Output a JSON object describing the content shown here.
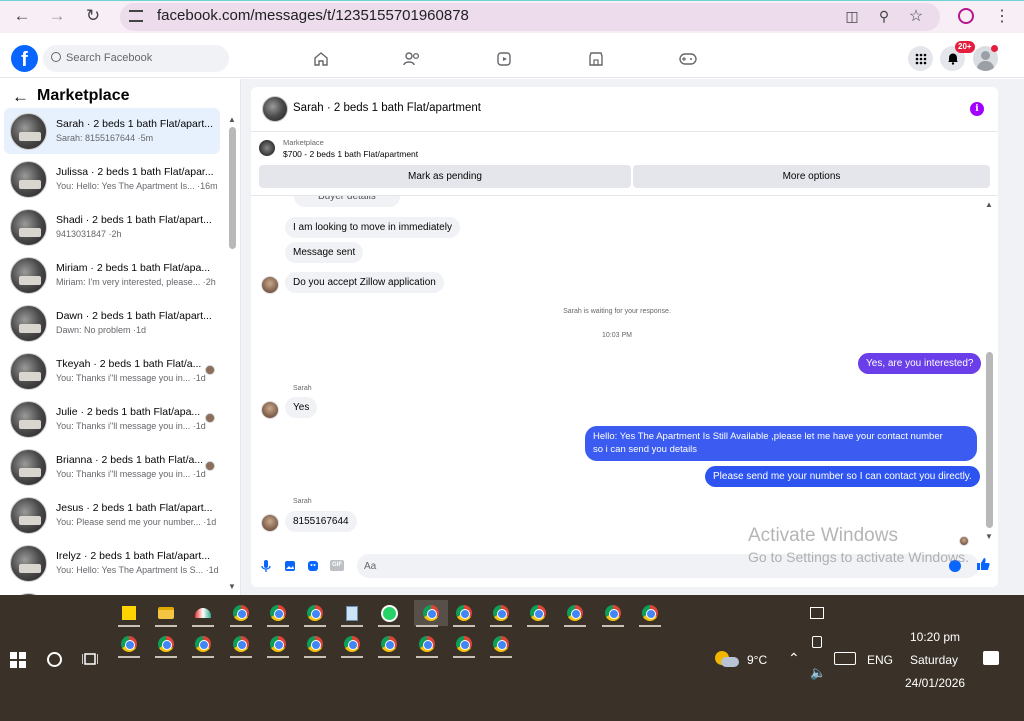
{
  "browser": {
    "url": "facebook.com/messages/t/1235155701960878"
  },
  "fb": {
    "search_placeholder": "Search Facebook",
    "notif_badge": "20+",
    "sidebar_title": "Marketplace"
  },
  "conversations": [
    {
      "title": "Sarah · 2 beds 1 bath Flat/apart...",
      "sub": "Sarah: 8155167644 ·5m"
    },
    {
      "title": "Julissa · 2 beds 1 bath Flat/apar...",
      "sub": "You: Hello: Yes The Apartment Is... ·16m"
    },
    {
      "title": "Shadi · 2 beds 1 bath Flat/apart...",
      "sub": "9413031847 ·2h"
    },
    {
      "title": "Miriam · 2 beds 1 bath Flat/apa...",
      "sub": "Miriam: I'm very interested, please... ·2h"
    },
    {
      "title": "Dawn · 2 beds 1 bath Flat/apart...",
      "sub": "Dawn: No problem ·1d"
    },
    {
      "title": "Tkeyah · 2 beds 1 bath Flat/a...",
      "sub": "You: Thanks i\"ll message you in... ·1d"
    },
    {
      "title": "Julie · 2 beds 1 bath Flat/apa...",
      "sub": "You: Thanks i\"ll message you in... ·1d"
    },
    {
      "title": "Brianna · 2 beds 1 bath Flat/a...",
      "sub": "You: Thanks i\"ll message you in... ·1d"
    },
    {
      "title": "Jesus · 2 beds 1 bath Flat/apart...",
      "sub": "You: Please send me your number... ·1d"
    },
    {
      "title": "Irelyz · 2 beds 1 bath Flat/apart...",
      "sub": "You: Hello: Yes The Apartment Is S... ·1d"
    }
  ],
  "chat": {
    "header_title": "Sarah · 2 beds 1 bath Flat/apartment",
    "listing_label": "Marketplace",
    "listing_title": "$700 - 2 beds 1 bath Flat/apartment",
    "mark_pending": "Mark as pending",
    "more_options": "More options",
    "partial_bubble": "Buyer details",
    "messages": {
      "m1": "I am looking to move in immediately",
      "m2": "Message sent",
      "m3": "Do you accept Zillow application",
      "waiting": "Sarah is waiting for your response.",
      "time": "10:03 PM",
      "r1": "Yes, are you interested?",
      "sender1": "Sarah",
      "m4": "Yes",
      "r2_line1": "Hello: Yes The Apartment Is Still Available ,please let me have your contact number",
      "r2_line2": "so i can send you details",
      "r3": "Please send me your number so I can contact you directly.",
      "sender2": "Sarah",
      "m5": "8155167644"
    },
    "composer_placeholder": "Aa"
  },
  "watermark": {
    "line1": "Activate Windows",
    "line2": "Go to Settings to activate Windows."
  },
  "taskbar": {
    "temp": "9°C",
    "lang": "ENG",
    "time": "10:20 pm",
    "day": "Saturday",
    "date": "24/01/2026"
  }
}
